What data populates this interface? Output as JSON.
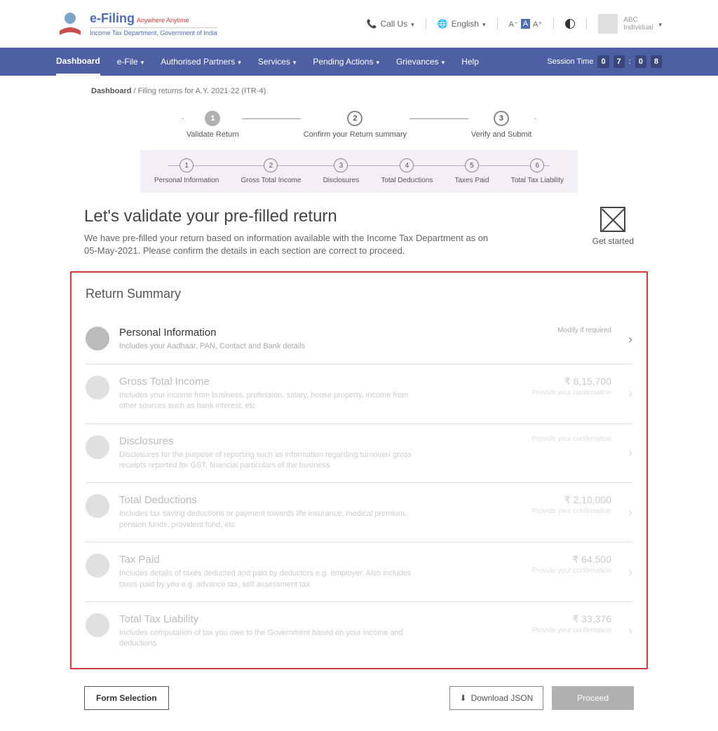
{
  "header": {
    "efiling": "e-Filing",
    "tagline": "Anywhere Anytime",
    "dept": "Income Tax Department, Government of India",
    "call_us": "Call Us",
    "language": "English",
    "font_small": "A⁻",
    "font_normal": "A",
    "font_large": "A⁺",
    "user_name": "ABC",
    "user_type": "Individual"
  },
  "nav": {
    "items": [
      "Dashboard",
      "e-File",
      "Authorised Partners",
      "Services",
      "Pending Actions",
      "Grievances",
      "Help"
    ],
    "session_label": "Session Time",
    "session_digits": [
      "0",
      "7",
      ":",
      "0",
      "8"
    ]
  },
  "breadcrumb": {
    "root": "Dashboard",
    "sep": " / ",
    "current": "Filing returns for A.Y. 2021-22 (ITR-4)"
  },
  "main_steps": [
    "Validate Return",
    "Confirm your Return summary",
    "Verify and Submit"
  ],
  "sub_steps": [
    "Personal Information",
    "Gross Total Income",
    "Disclosures",
    "Total Deductions",
    "Taxes Paid",
    "Total Tax Liability"
  ],
  "validate": {
    "title": "Let's validate your pre-filled return",
    "desc": "We have pre-filled your return based on information available with the Income Tax Department as on 05-May-2021. Please confirm the details in each section are correct to proceed.",
    "get_started": "Get started"
  },
  "summary": {
    "title": "Return Summary",
    "items": [
      {
        "title": "Personal Information",
        "desc": "Includes your Aadhaar, PAN, Contact and Bank details",
        "amount": "",
        "note": "Modify if required",
        "active": true
      },
      {
        "title": "Gross Total Income",
        "desc": "Includes your income from business, profession,  salary, house property, income from other sources such as bank interest, etc",
        "amount": "₹ 8,15,700",
        "note": "Provide your confirmation"
      },
      {
        "title": "Disclosures",
        "desc": "Disclosures for the purpose of reporting such as information regarding turnover/ gross receipts reported for GST, financial particulars of the business",
        "amount": "",
        "note": "Provide your confirmation"
      },
      {
        "title": "Total Deductions",
        "desc": "Includes tax saving deductions or payment towards life insurance, medical premium, pension funds, provident fund, etc",
        "amount": "₹ 2,10,000",
        "note": "Provide your confirmation"
      },
      {
        "title": "Tax Paid",
        "desc": "Includes details of taxes deducted and paid by deductors e.g. employer. Also includes taxes paid by you e.g. advance tax, self assessment tax",
        "amount": "₹ 64,500",
        "note": "Provide your confirmation"
      },
      {
        "title": "Total Tax Liability",
        "desc": "Includes computation of tax you owe to the Government based on your income and deductions",
        "amount": "₹ 33,376",
        "note": "Provide your confirmation"
      }
    ]
  },
  "footer": {
    "form_selection": "Form Selection",
    "download_json": "Download JSON",
    "proceed": "Proceed"
  }
}
